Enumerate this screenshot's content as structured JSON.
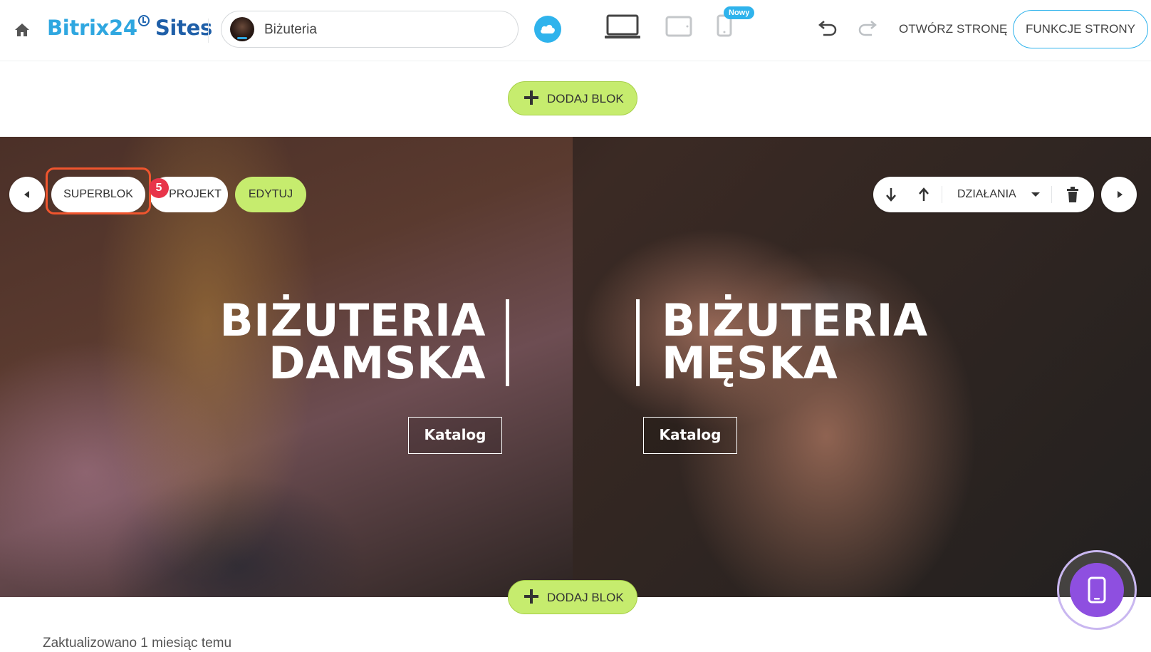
{
  "topbar": {
    "logo_part1": "Bitrix24",
    "logo_part2": "Sites",
    "site_name": "Biżuteria",
    "new_badge": "Nowy",
    "open_page": "OTWÓRZ STRONĘ",
    "site_features": "FUNKCJE STRONY",
    "icons": [
      "home-icon",
      "cloud-icon",
      "laptop-icon",
      "tablet-icon",
      "phone-icon",
      "undo-icon",
      "redo-icon"
    ]
  },
  "add_block": {
    "label": "DODAJ BLOK"
  },
  "block_toolbar": {
    "superblock": "SUPERBLOK",
    "design": "PROJEKT",
    "edit": "EDYTUJ",
    "actions": "DZIAŁANIA",
    "step_number": "5"
  },
  "hero": {
    "left": {
      "line1": "BIŻUTERIA",
      "line2": "DAMSKA",
      "button": "Katalog"
    },
    "right": {
      "line1": "BIŻUTERIA",
      "line2": "MĘSKA",
      "button": "Katalog"
    }
  },
  "footer": {
    "updated": "Zaktualizowano 1 miesiąc temu"
  },
  "colors": {
    "brand_blue": "#2fa7e0",
    "accent_green": "#c6ec6e",
    "highlight_orange": "#f0552e",
    "badge_red": "#e8354a",
    "preview_purple": "#8e4fe0"
  }
}
